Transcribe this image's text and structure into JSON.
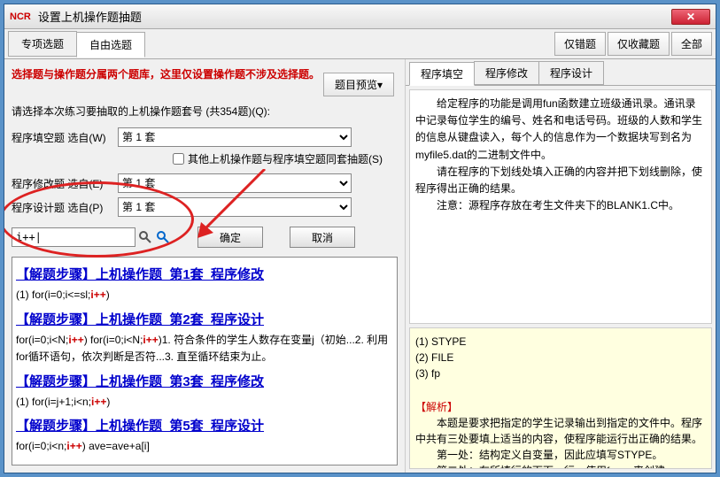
{
  "title": "设置上机操作题抽题",
  "logo": "NCR",
  "tabs": {
    "special": "专项选题",
    "free": "自由选题"
  },
  "filters": {
    "wrong": "仅错题",
    "fav": "仅收藏题",
    "all": "全部"
  },
  "preview_btn": "题目预览",
  "warning": "选择题与操作题分属两个题库，这里仅设置操作题不涉及选择题。",
  "instruction": "请选择本次练习要抽取的上机操作题套号 (共354题)(Q):",
  "rows": {
    "fill": {
      "label": "程序填空题 选自(W)",
      "value": "第 1 套"
    },
    "modify": {
      "label": "程序修改题 选自(E)",
      "value": "第 1 套"
    },
    "design": {
      "label": "程序设计题 选自(P)",
      "value": "第 1 套"
    }
  },
  "checkbox_label": "其他上机操作题与程序填空题同套抽题(S)",
  "search_value": "i++|",
  "ok": "确定",
  "cancel": "取消",
  "results": [
    {
      "title": "【解题步骤】上机操作题_第1套_程序修改",
      "desc_parts": [
        "(1) for(i=0;i<=sl;",
        "i++",
        ")"
      ]
    },
    {
      "title": "【解题步骤】上机操作题_第2套_程序设计",
      "desc_parts": [
        "for(i=0;i<N;",
        "i++",
        ") for(i=0;i<N;",
        "i++",
        ")1. 符合条件的学生人数存在变量j（初始...2. 利用for循环语句，依次判断是否符...3. 直至循环结束为止。"
      ]
    },
    {
      "title": "【解题步骤】上机操作题_第3套_程序修改",
      "desc_parts": [
        "(1) for(i=j+1;i<n;",
        "i++",
        ")"
      ]
    },
    {
      "title": "【解题步骤】上机操作题_第5套_程序设计",
      "desc_parts": [
        "for(i=0;i<n;",
        "i++",
        ") ave=ave+a[i]"
      ]
    }
  ],
  "rtabs": {
    "fill": "程序填空",
    "modify": "程序修改",
    "design": "程序设计"
  },
  "problem": {
    "p1": "给定程序的功能是调用fun函数建立班级通讯录。通讯录中记录每位学生的编号、姓名和电话号码。班级的人数和学生的信息从键盘读入，每个人的信息作为一个数据块写到名为myfile5.dat的二进制文件中。",
    "p2": "请在程序的下划线处填入正确的内容并把下划线删除，使程序得出正确的结果。",
    "p3": "注意：源程序存放在考生文件夹下的BLANK1.C中。"
  },
  "answer": {
    "l1": "(1) STYPE",
    "l2": "(2) FILE",
    "l3": "(3) fp",
    "head": "【解析】",
    "body1": "本题是要求把指定的学生记录输出到指定的文件中。程序中共有三处要填上适当的内容，使程序能运行出正确的结果。",
    "body2": "第一处：结构定义自变量，因此应填写STYPE。",
    "body3": "第二处：在所填行的下面一行，使用fopen来创建"
  }
}
